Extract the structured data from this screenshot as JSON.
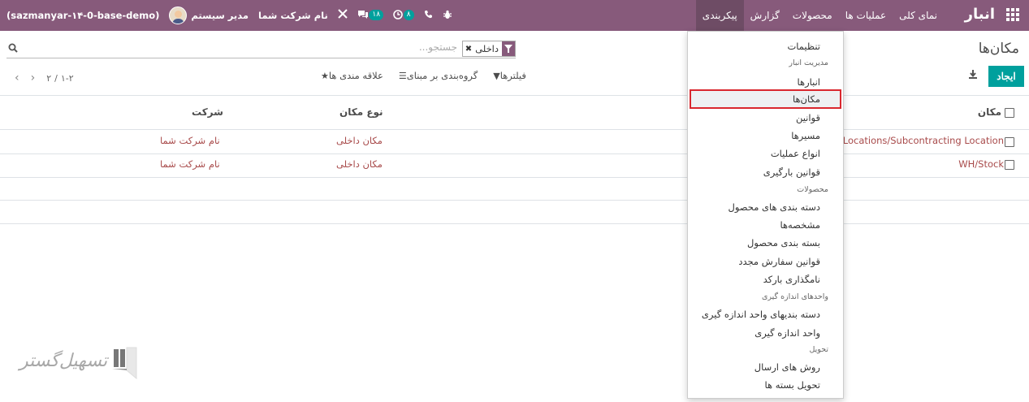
{
  "navbar": {
    "brand": "انبار",
    "menu": [
      {
        "label": "نمای کلی",
        "active": false
      },
      {
        "label": "عملیات ها",
        "active": false
      },
      {
        "label": "محصولات",
        "active": false
      },
      {
        "label": "گزارش",
        "active": false
      },
      {
        "label": "پیکربندی",
        "active": true
      }
    ],
    "company": "نام شرکت شما",
    "user": "مدیر سیستم",
    "db": "(sazmanyar-۱۴-0-base-demo)",
    "activity_badge": "۸",
    "messages_badge": "۱۸",
    "color": "#875a7b"
  },
  "control": {
    "breadcrumb": "مکان‌ها",
    "create_label": "ایجاد",
    "search_placeholder": "جستجو...",
    "facet_value": "داخلی",
    "filters_label": "فیلترها",
    "groupby_label": "گروه‌بندی بر مبنای",
    "favorites_label": "علاقه مندی ها",
    "pager_value": "۱-۲",
    "pager_total": "۲",
    "accent": "#00a09d"
  },
  "list": {
    "columns": {
      "location": "مکان",
      "location_type": "نوع مکان",
      "company": "شرکت"
    },
    "rows": [
      {
        "location": "al Locations/Subcontracting Location",
        "location_type": "مکان داخلی",
        "company": "نام شرکت شما"
      },
      {
        "location": "WH/Stock",
        "location_type": "مکان داخلی",
        "company": "نام شرکت شما"
      }
    ]
  },
  "dropdown": {
    "settings": "تنظیمات",
    "h_warehouse": "مدیریت انبار",
    "warehouses": "انبارها",
    "locations": "مکان‌ها",
    "rules": "قوانین",
    "routes": "مسیرها",
    "operation_types": "انواع عملیات",
    "putaway_rules": "قوانین بارگیری",
    "h_products": "محصولات",
    "product_categories": "دسته بندی های محصول",
    "attributes": "مشخصه‌ها",
    "product_packagings": "بسته بندی محصول",
    "reordering_rules": "قوانین سفارش مجدد",
    "barcode_nomenclatures": "نامگذاری بارکد",
    "h_uom": "واحدهای اندازه گیری",
    "uom_categories": "دسته بندیهای واحد اندازه گیری",
    "uom": "واحد اندازه گیری",
    "h_delivery": "تحویل",
    "shipping_methods": "روش های ارسال",
    "delivery_packages": "تحویل بسته ها",
    "highlight_color": "#d9272e"
  },
  "watermark": {
    "text": "تسهیل‌گستر"
  }
}
